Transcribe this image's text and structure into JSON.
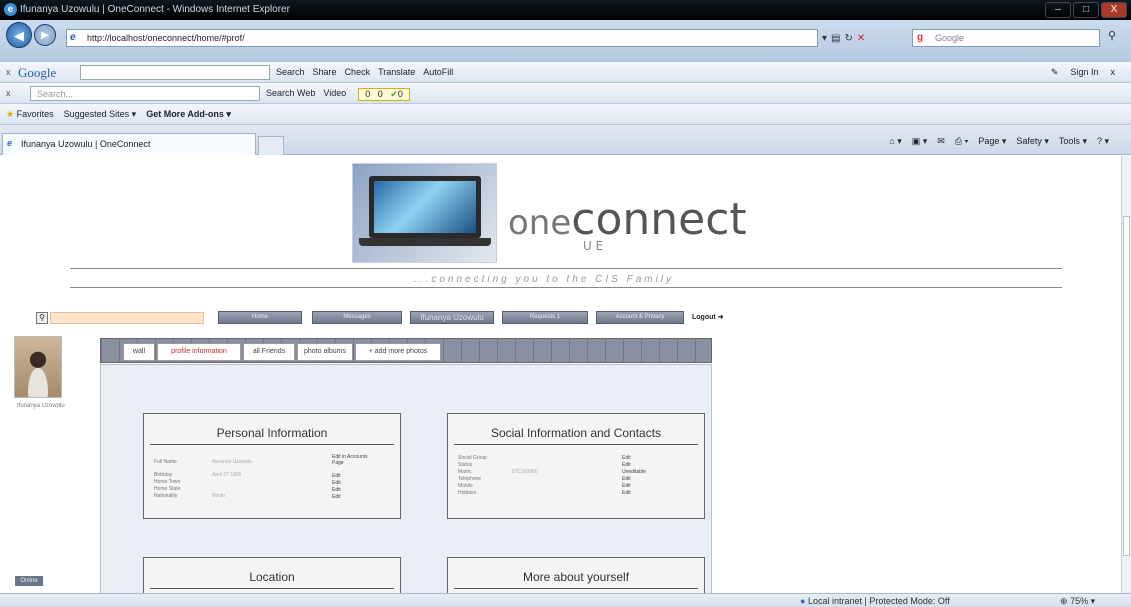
{
  "window": {
    "title": "Ifunanya Uzowulu | OneConnect - Windows Internet Explorer",
    "minimize": "–",
    "maximize": "□",
    "close": "X"
  },
  "addressbar": {
    "url": "http://localhost/oneconnect/home/#prof/",
    "search_placeholder": "Google"
  },
  "google_toolbar": {
    "logo": "Google",
    "items": [
      "Search",
      "Share",
      "Check",
      "Translate",
      "AutoFill"
    ],
    "sign_in": "Sign In"
  },
  "search_toolbar": {
    "placeholder": "Search...",
    "search_web": "Search Web",
    "video": "Video",
    "count1": "0",
    "count2": "0",
    "count3": "0"
  },
  "favorites_bar": {
    "favorites": "Favorites",
    "suggested": "Suggested Sites",
    "addons": "Get More Add-ons"
  },
  "browser_tab": {
    "label": "Ifunanya Uzowulu | OneConnect"
  },
  "command_bar": {
    "page": "Page",
    "safety": "Safety",
    "tools": "Tools"
  },
  "site": {
    "brand_one": "one",
    "brand_connect": "connect",
    "brand_sub": "U E",
    "tagline": "...connecting you to the CIS Family",
    "menu": [
      "Home",
      "Messages",
      "Ifunanya Uzowulu",
      "Requests 1",
      "Account & Privacy"
    ],
    "logout": "Logout",
    "avatar_name": "Ifunanya Uzowulu",
    "online": "Online"
  },
  "profile_tabs": [
    "wall",
    "profile information",
    "all Friends",
    "photo albums",
    "+ add more photos"
  ],
  "personal": {
    "title": "Personal Information",
    "rows": [
      {
        "label": "Full Name",
        "value": "Ifunanya Uzowulu",
        "edit": "Edit in Accounts Page"
      },
      {
        "label": "Birthday",
        "value": "April 27 1995",
        "edit": "Edit"
      },
      {
        "label": "Home Town",
        "value": "",
        "edit": "Edit"
      },
      {
        "label": "Home State",
        "value": "",
        "edit": "Edit"
      },
      {
        "label": "Nationality",
        "value": "Benin",
        "edit": "Edit"
      }
    ]
  },
  "social": {
    "title": "Social Information and Contacts",
    "rows": [
      {
        "label": "Social Group",
        "value": "",
        "edit": "Edit"
      },
      {
        "label": "Status",
        "value": "",
        "edit": "Edit"
      },
      {
        "label": "Matric",
        "value": "07CJ00980",
        "edit": "Uneditable"
      },
      {
        "label": "Telephone",
        "value": "",
        "edit": "Edit"
      },
      {
        "label": "Mobile",
        "value": "",
        "edit": "Edit"
      },
      {
        "label": "Hobbies",
        "value": "",
        "edit": "Edit"
      }
    ]
  },
  "location": {
    "title": "Location"
  },
  "more": {
    "title": "More about yourself"
  },
  "statusbar": {
    "zone": "Local intranet | Protected Mode: Off",
    "zoom": "75%"
  }
}
